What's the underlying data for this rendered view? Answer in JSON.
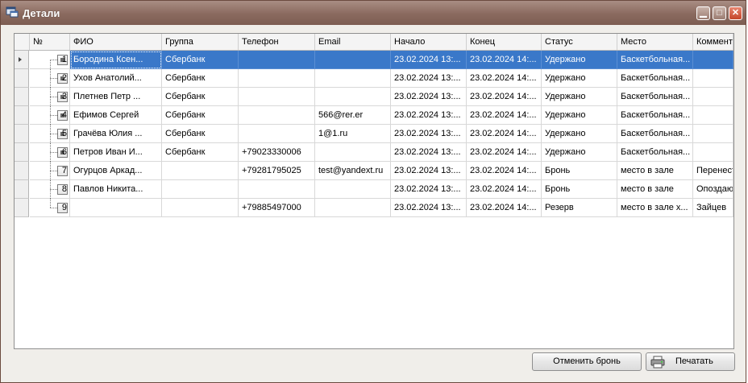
{
  "window": {
    "title": "Детали",
    "title_icon": "details-window-icon",
    "min_icon": "minimize-icon",
    "max_icon": "maximize-icon",
    "close_icon": "close-icon"
  },
  "grid": {
    "columns": [
      "№",
      "ФИО",
      "Группа",
      "Телефон",
      "Email",
      "Начало",
      "Конец",
      "Статус",
      "Место",
      "Коммента..."
    ],
    "selected_row": 0,
    "rows": [
      {
        "num": "1",
        "checked": "indeterminate",
        "fio": "Бородина Ксен...",
        "group": "Сбербанк",
        "phone": "",
        "email": "",
        "start": "23.02.2024 13:...",
        "end": "23.02.2024 14:...",
        "status": "Удержано",
        "place": "Баскетбольная...",
        "comment": ""
      },
      {
        "num": "2",
        "checked": "indeterminate",
        "fio": "Ухов Анатолий...",
        "group": "Сбербанк",
        "phone": "",
        "email": "",
        "start": "23.02.2024 13:...",
        "end": "23.02.2024 14:...",
        "status": "Удержано",
        "place": "Баскетбольная...",
        "comment": ""
      },
      {
        "num": "3",
        "checked": "indeterminate",
        "fio": "Плетнев Петр ...",
        "group": "Сбербанк",
        "phone": "",
        "email": "",
        "start": "23.02.2024 13:...",
        "end": "23.02.2024 14:...",
        "status": "Удержано",
        "place": "Баскетбольная...",
        "comment": ""
      },
      {
        "num": "4",
        "checked": "indeterminate",
        "fio": "Ефимов Сергей",
        "group": "Сбербанк",
        "phone": "",
        "email": "566@rer.er",
        "start": "23.02.2024 13:...",
        "end": "23.02.2024 14:...",
        "status": "Удержано",
        "place": "Баскетбольная...",
        "comment": ""
      },
      {
        "num": "5",
        "checked": "indeterminate",
        "fio": "Грачёва Юлия ...",
        "group": "Сбербанк",
        "phone": "",
        "email": "1@1.ru",
        "start": "23.02.2024 13:...",
        "end": "23.02.2024 14:...",
        "status": "Удержано",
        "place": "Баскетбольная...",
        "comment": ""
      },
      {
        "num": "6",
        "checked": "indeterminate",
        "fio": "Петров Иван И...",
        "group": "Сбербанк",
        "phone": "+79023330006",
        "email": "",
        "start": "23.02.2024 13:...",
        "end": "23.02.2024 14:...",
        "status": "Удержано",
        "place": "Баскетбольная...",
        "comment": ""
      },
      {
        "num": "7",
        "checked": "unchecked",
        "fio": "Огурцов Аркад...",
        "group": "",
        "phone": "+79281795025",
        "email": "test@yandext.ru",
        "start": "23.02.2024 13:...",
        "end": "23.02.2024 14:...",
        "status": "Бронь",
        "place": "место в зале",
        "comment": "Перенест..."
      },
      {
        "num": "8",
        "checked": "unchecked",
        "fio": "Павлов Никита...",
        "group": "",
        "phone": "",
        "email": "",
        "start": "23.02.2024 13:...",
        "end": "23.02.2024 14:...",
        "status": "Бронь",
        "place": "место в зале",
        "comment": "Опоздаю ..."
      },
      {
        "num": "9",
        "checked": "unchecked",
        "fio": "",
        "group": "",
        "phone": "+79885497000",
        "email": "",
        "start": "23.02.2024 13:...",
        "end": "23.02.2024 14:...",
        "status": "Резерв",
        "place": "место в зале х...",
        "comment": "Зайцев"
      }
    ]
  },
  "buttons": {
    "cancel_booking": "Отменить бронь",
    "print": "Печатать",
    "print_icon": "printer-icon"
  },
  "colors": {
    "title_bar": "#8a6a5f",
    "selection": "#3a78c9"
  }
}
